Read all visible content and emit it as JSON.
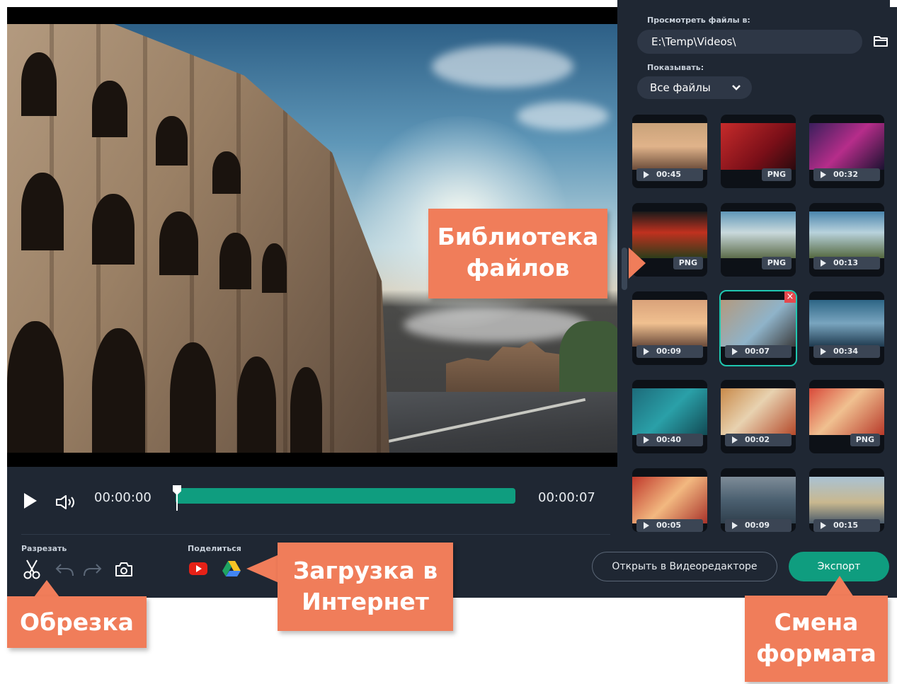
{
  "player": {
    "time_current": "00:00:00",
    "time_total": "00:00:07",
    "progress": 1.0
  },
  "sidebar": {
    "browse_label": "Просмотреть файлы в:",
    "path_value": "E:\\Temp\\Videos\\",
    "show_label": "Показывать:",
    "filter_value": "Все файлы",
    "thumbnails": [
      {
        "badge": "00:45"
      },
      {
        "badge": "PNG"
      },
      {
        "badge": "00:32"
      },
      {
        "badge": "PNG"
      },
      {
        "badge": "PNG"
      },
      {
        "badge": "00:13"
      },
      {
        "badge": "00:09"
      },
      {
        "badge": "00:07"
      },
      {
        "badge": "00:34"
      },
      {
        "badge": "00:40"
      },
      {
        "badge": "00:02"
      },
      {
        "badge": "PNG"
      },
      {
        "badge": "00:05"
      },
      {
        "badge": "00:09"
      },
      {
        "badge": "00:15"
      }
    ],
    "selected_index": 7
  },
  "bottom": {
    "cut_label": "Разрезать",
    "share_label": "Поделиться",
    "open_editor_label": "Открыть в Видеоредакторе",
    "export_label": "Экспорт"
  },
  "callouts": {
    "library": "Библиотека файлов",
    "upload": "Загрузка в Интернет",
    "trim": "Обрезка",
    "format": "Смена формата"
  },
  "colors": {
    "accent": "#0f9d7f",
    "callout": "#f07d5a",
    "background": "#1f2733"
  }
}
